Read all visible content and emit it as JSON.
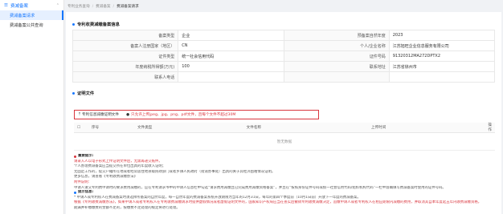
{
  "sidebar": {
    "title": "费减备案",
    "items": [
      {
        "label": "费减备案请求",
        "active": true
      },
      {
        "label": "费减备案公共查询",
        "active": false
      }
    ]
  },
  "breadcrumb": [
    "专利业务查询",
    "费减备案",
    "费减备案请求"
  ],
  "section1": {
    "title": "专利收费减缴备案信息",
    "rows": [
      {
        "l1": "备案类型",
        "v1": "企业",
        "l2": "预备案自然年度",
        "v2": "2023"
      },
      {
        "l1": "备案人注册国家（地区）",
        "v1": "CN",
        "l2": "个人/企业名称",
        "v2": "江苏旭旺企业信息服务有限公司"
      },
      {
        "l1": "证件类型",
        "v1": "统一社会信用代码",
        "l2": "证件号码",
        "v2": "91320312MA272DPTX2"
      },
      {
        "l1": "年度纳税所得额(万元)",
        "v1": "100",
        "l2": "联系地址",
        "v2": "江苏省徐州市"
      },
      {
        "l1": "联系人电话",
        "v1": "",
        "l2": "",
        "v2": ""
      }
    ]
  },
  "section2": {
    "title": "证明文件",
    "upload_button": "专利信息减缴证明文件",
    "upload_hint": "只允许上传jpeg、jpg、png、pdf文件，且每个文件不超过30M",
    "columns": [
      "序号",
      "文件类型",
      "文件名称",
      "上传时间",
      "操作"
    ],
    "empty_text": "暂无数据"
  },
  "notes": {
    "title1": "重要提示:",
    "lines1": [
      "请录入人以电子形式上传证明文件后，无需再递交纸件。",
      "个人办理费减备案应当提交所在单位出具的年度收入证明；",
      "无固定工作的，提交户籍所在地或者经常居住地县级民政部门或者乡镇人民政府（街道办事处）出具的关于其经济困难情况证明。",
      "更多信息，请查看《专利收费减缴办法》",
      "附件说明：",
      "申请人请交专利费申请时的要求费用减缴的，应在专利请求书中的申请人信息栏中勾选“请求费用减缴且已完成费用减缴资格备案”，并且在“按照身份证件号码或统一社会信用代码/组织机构代码”一栏中准确填写费减备案时使用的证件号码。"
    ],
    "title2": "提示信息:",
    "lines2": [
      "* 申请人或专利权人在费减备案时须选择所备案的自然年度，每一自然年度的费减备案系统开放期限为当年的12月31日，每年的第四个季度前（10月1日前）开放下一年度的费减备案。",
      "根据《专利收费减缴办法》，如果申请人或者专利权人在专利收费减缴请求时提供虚假情况或者虚假证明文件的，国家知识产权局应当在查实后撤销专利收费减缴决定，追缴申请人或者专利权人在相应期限内减缴的费用，并取消其自本年度起五年内收费减缴资格，"
    ],
    "tail": "期满并补缴缴费的金额不足的，按缴费不足处理的规定将进行处理。"
  }
}
